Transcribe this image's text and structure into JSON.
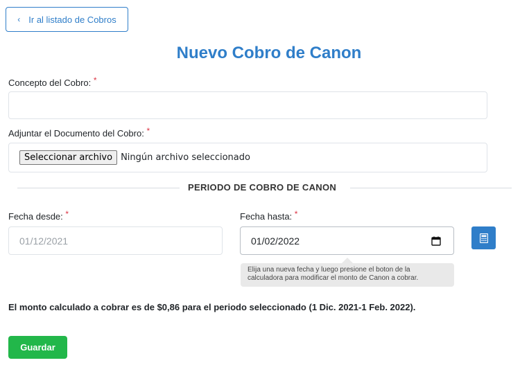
{
  "nav": {
    "back_label": "Ir al listado de Cobros",
    "back_icon": "chevron-left-icon"
  },
  "page": {
    "title": "Nuevo Cobro de Canon"
  },
  "form": {
    "concepto": {
      "label": "Concepto del Cobro:",
      "required_mark": "*",
      "value": ""
    },
    "documento": {
      "label": "Adjuntar el Documento del Cobro:",
      "required_mark": "*",
      "button_label": "Seleccionar archivo",
      "status_text": "Ningún archivo seleccionado"
    },
    "section_title": "PERIODO DE COBRO DE CANON",
    "fecha_desde": {
      "label": "Fecha desde:",
      "required_mark": "*",
      "value": "01/12/2021"
    },
    "fecha_hasta": {
      "label": "Fecha hasta:",
      "required_mark": "*",
      "value": "01/02/2022"
    },
    "calc_button_icon": "calculator-icon",
    "hint_text": "Elija una nueva fecha y luego presione el boton de la calculadora para modificar el monto de Canon a cobrar.",
    "summary_text": "El monto calculado a cobrar es de $0,86 para el periodo seleccionado (1 Dic. 2021-1 Feb. 2022).",
    "save_label": "Guardar"
  },
  "colors": {
    "primary": "#2f7ec9",
    "success": "#22b74a",
    "required": "#dc3545"
  }
}
